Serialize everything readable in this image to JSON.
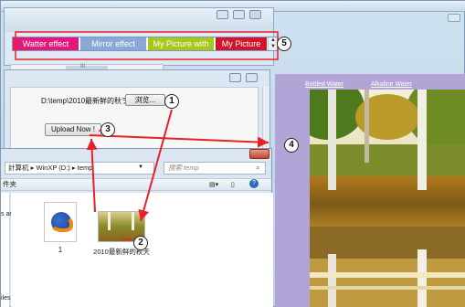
{
  "top_window": {
    "effects": [
      {
        "label": "Watter effect",
        "color": "#e6177a"
      },
      {
        "label": "Mirror effect",
        "color": "#8aa7d8"
      },
      {
        "label": "My Picture with",
        "color": "#a5c81a"
      },
      {
        "label": "My Picture",
        "color": "#d4142a"
      }
    ],
    "scroll_marker": "III"
  },
  "background_page": {
    "links": [
      "Bottled Water",
      "Alkaline Water"
    ]
  },
  "upload_window": {
    "file_path": "D:\\temp\\2010最新鲜的秋ヲ",
    "browse_button": "浏览...",
    "upload_button": "Upload Now !"
  },
  "explorer": {
    "address_parts": [
      "計算机",
      "WinXP (D:)",
      "temp"
    ],
    "search_placeholder": "搜索 temp",
    "toolbar_label": "件夹",
    "left_pane_fragments": [
      "s ar",
      "iles"
    ],
    "files": [
      {
        "name": "1",
        "icon": "firefox-icon"
      },
      {
        "name": "2010最新鲜的秋天",
        "icon": "autumn-image-thumbnail"
      }
    ]
  },
  "callouts": [
    "1",
    "2",
    "3",
    "4",
    "5"
  ],
  "colors": {
    "arrow": "#e8202a",
    "highlight_box": "#e8202a"
  }
}
